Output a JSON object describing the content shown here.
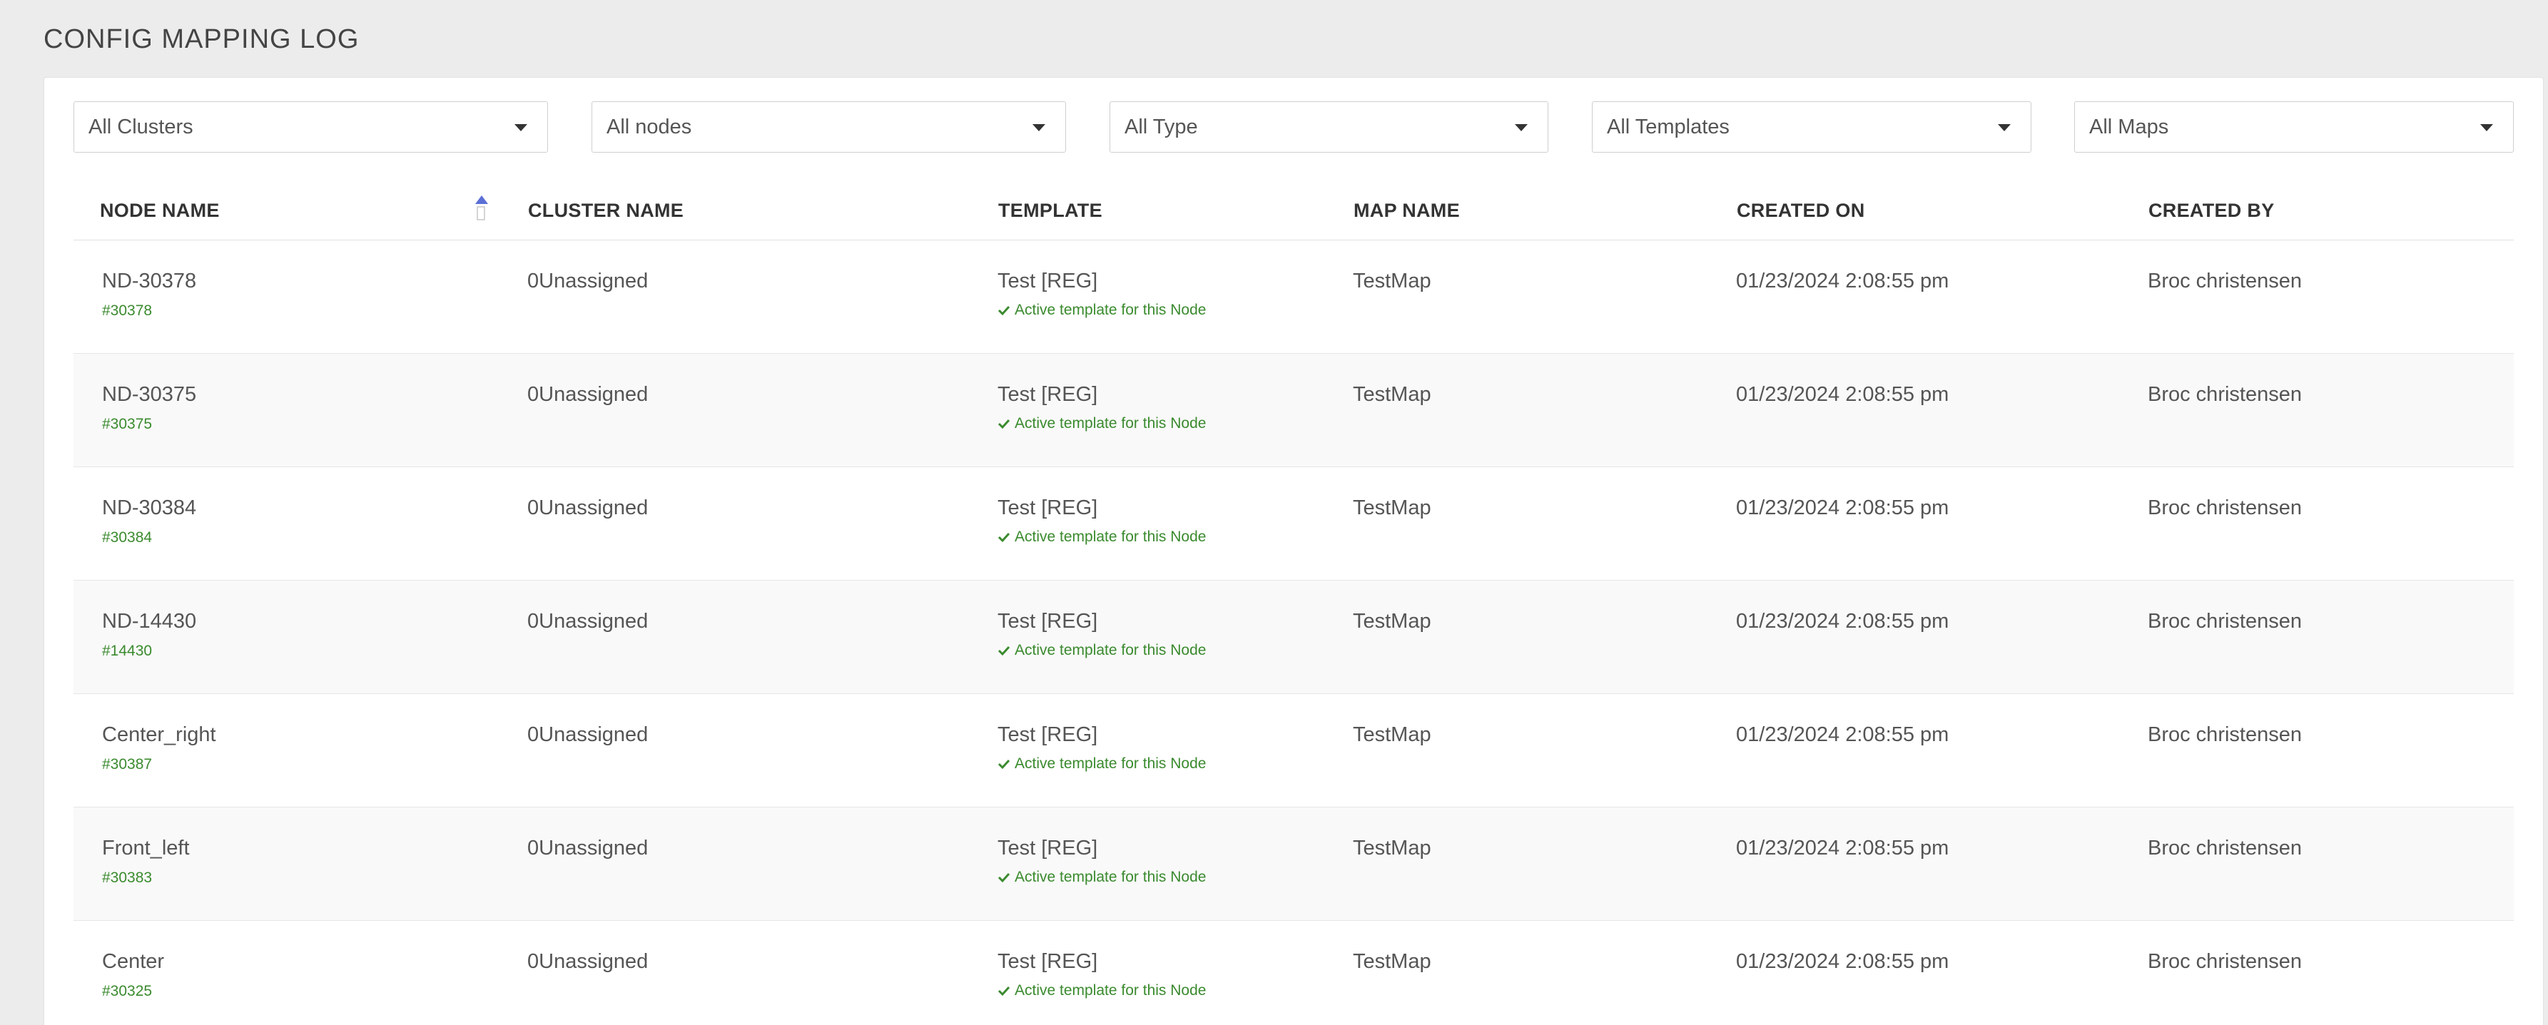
{
  "page": {
    "title": "CONFIG MAPPING LOG"
  },
  "filters": {
    "clusters": "All Clusters",
    "nodes": "All nodes",
    "type": "All Type",
    "templates": "All Templates",
    "maps": "All Maps"
  },
  "table": {
    "headers": {
      "node_name": "NODE NAME",
      "cluster_name": "CLUSTER NAME",
      "template": "TEMPLATE",
      "map_name": "MAP NAME",
      "created_on": "CREATED ON",
      "created_by": "CREATED BY"
    },
    "sort": {
      "column": "node_name",
      "direction": "ascending",
      "icon": "sort-ascending-icon"
    },
    "rows": [
      {
        "node_name": "ND-30378",
        "node_id": "#30378",
        "cluster_name": "0Unassigned",
        "template": "Test [REG]",
        "template_note": "Active template for this Node",
        "map_name": "TestMap",
        "created_on": "01/23/2024 2:08:55 pm",
        "created_by": "Broc christensen"
      },
      {
        "node_name": "ND-30375",
        "node_id": "#30375",
        "cluster_name": "0Unassigned",
        "template": "Test [REG]",
        "template_note": "Active template for this Node",
        "map_name": "TestMap",
        "created_on": "01/23/2024 2:08:55 pm",
        "created_by": "Broc christensen"
      },
      {
        "node_name": "ND-30384",
        "node_id": "#30384",
        "cluster_name": "0Unassigned",
        "template": "Test [REG]",
        "template_note": "Active template for this Node",
        "map_name": "TestMap",
        "created_on": "01/23/2024 2:08:55 pm",
        "created_by": "Broc christensen"
      },
      {
        "node_name": "ND-14430",
        "node_id": "#14430",
        "cluster_name": "0Unassigned",
        "template": "Test [REG]",
        "template_note": "Active template for this Node",
        "map_name": "TestMap",
        "created_on": "01/23/2024 2:08:55 pm",
        "created_by": "Broc christensen"
      },
      {
        "node_name": "Center_right",
        "node_id": "#30387",
        "cluster_name": "0Unassigned",
        "template": "Test [REG]",
        "template_note": "Active template for this Node",
        "map_name": "TestMap",
        "created_on": "01/23/2024 2:08:55 pm",
        "created_by": "Broc christensen"
      },
      {
        "node_name": "Front_left",
        "node_id": "#30383",
        "cluster_name": "0Unassigned",
        "template": "Test [REG]",
        "template_note": "Active template for this Node",
        "map_name": "TestMap",
        "created_on": "01/23/2024 2:08:55 pm",
        "created_by": "Broc christensen"
      },
      {
        "node_name": "Center",
        "node_id": "#30325",
        "cluster_name": "0Unassigned",
        "template": "Test [REG]",
        "template_note": "Active template for this Node",
        "map_name": "TestMap",
        "created_on": "01/23/2024 2:08:55 pm",
        "created_by": "Broc christensen"
      }
    ]
  },
  "colors": {
    "background": "#ececec",
    "card": "#ffffff",
    "accent_green": "#3a8a2e",
    "sort_icon": "#5b6fd6"
  }
}
